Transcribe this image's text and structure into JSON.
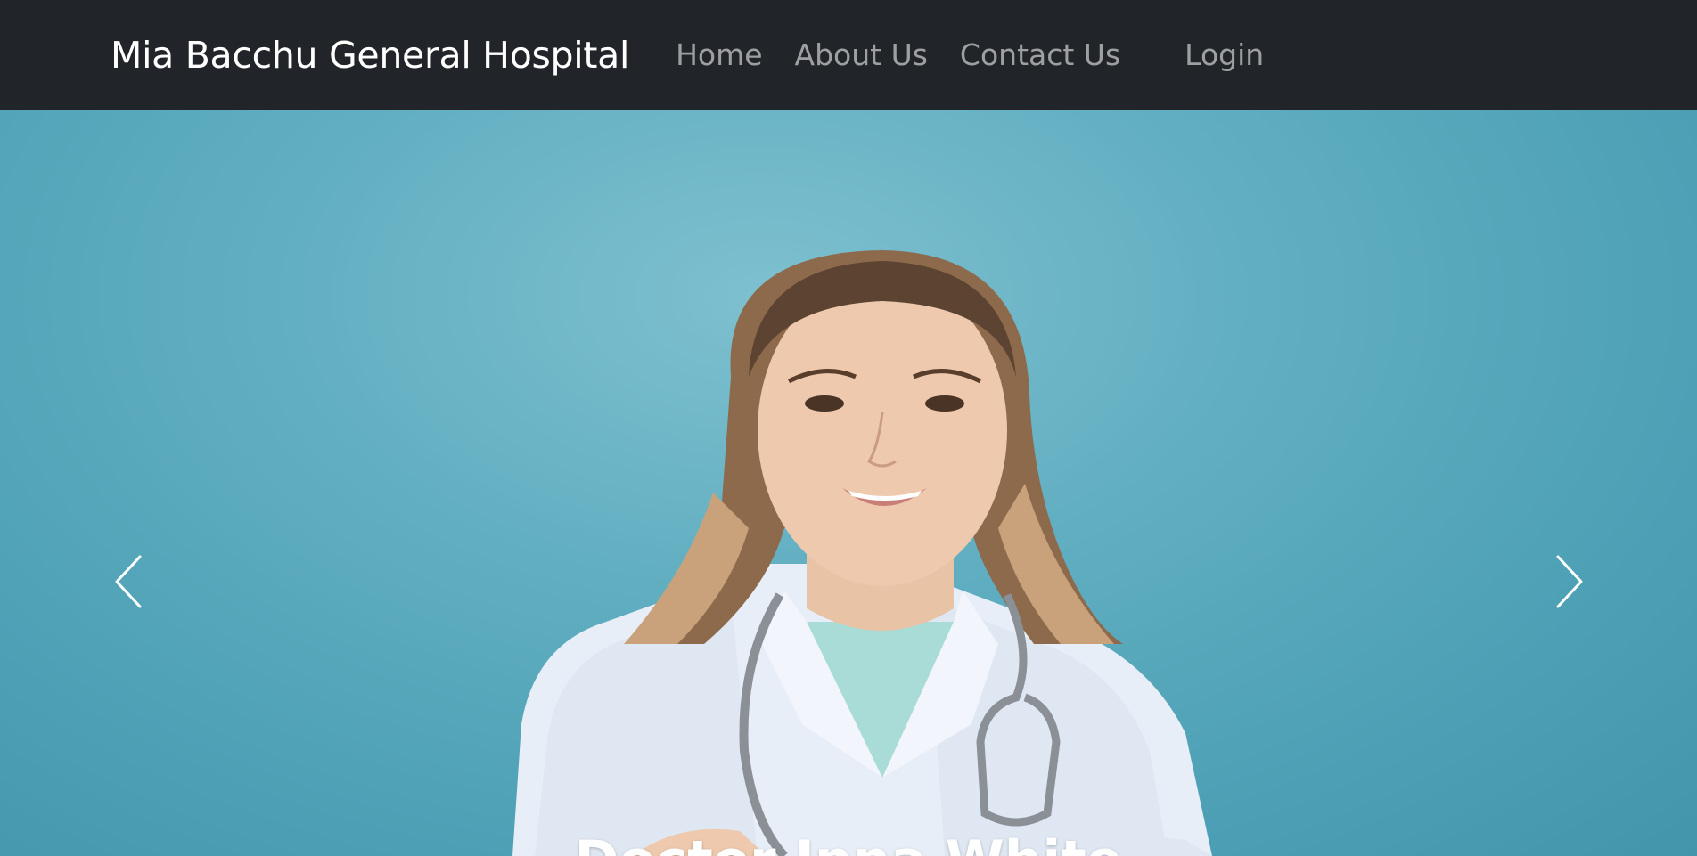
{
  "navbar": {
    "brand": "Mia Bacchu General Hospital",
    "links": [
      {
        "label": "Home"
      },
      {
        "label": "About Us"
      },
      {
        "label": "Contact Us"
      }
    ],
    "login_label": "Login"
  },
  "carousel": {
    "caption": "Doctor Inna White",
    "prev_icon": "chevron-left-icon",
    "next_icon": "chevron-right-icon"
  },
  "colors": {
    "navbar_bg": "#212529",
    "slide_bg": "#5fadc0",
    "brand_text": "#ffffff"
  }
}
